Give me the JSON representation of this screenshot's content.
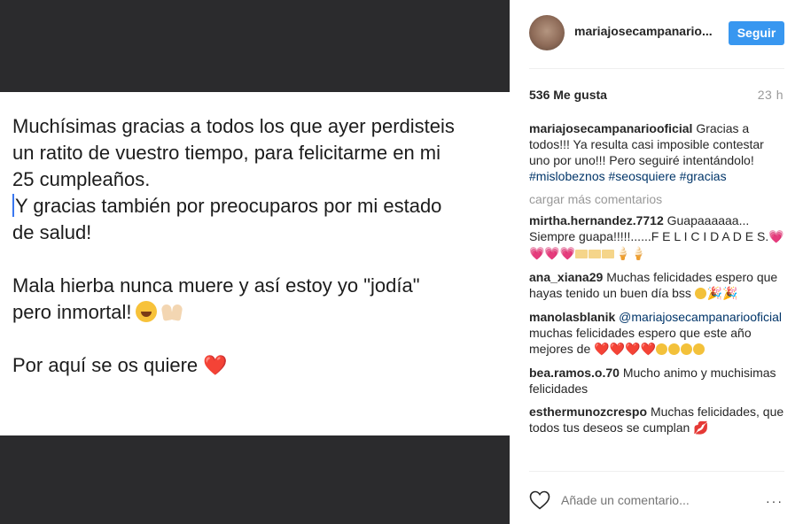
{
  "post": {
    "line1": "Muchísimas gracias a todos los que ayer perdisteis",
    "line2": "un ratito de vuestro tiempo, para felicitarme en mi",
    "line3": "25 cumpleaños.",
    "line4": "Y gracias también por preocuparos por mi estado",
    "line5": "de salud!",
    "line6": "Mala hierba nunca muere y así estoy yo \"jodía\"",
    "line7": "pero inmortal!",
    "line8": "Por aquí se os quiere",
    "heart": "❤️"
  },
  "header": {
    "username": "mariajosecampanario...",
    "follow_label": "Seguir"
  },
  "stats": {
    "likes": "536 Me gusta",
    "time": "23 h"
  },
  "caption": {
    "user": "mariajosecampanariooficial",
    "text": "Gracias a todos!!! Ya resulta casi imposible contestar uno por uno!!! Pero seguiré intentándolo!",
    "tag1": "#mislobeznos",
    "tag2": "#seosquiere",
    "tag3": "#gracias"
  },
  "load_more": "cargar más comentarios",
  "comments": [
    {
      "user": "mirtha.hernandez.7712",
      "text": "Guapaaaaaa... Siempre guapa!!!!!......F E L I C I D A D E S.",
      "emoji": "💗💗💗💗"
    },
    {
      "user": "ana_xiana29",
      "text": "Muchas felicidades espero que hayas tenido un buen día bss",
      "emoji": "🎉🎉"
    },
    {
      "user": "manolasblanik",
      "mention": "@mariajosecampanariooficial",
      "text": "muchas felicidades espero que este año mejores de",
      "emoji": "❤️❤️❤️❤️"
    },
    {
      "user": "bea.ramos.o.70",
      "text": "Mucho animo y muchisimas felicidades"
    },
    {
      "user": "esthermunozcrespo",
      "text": "Muchas felicidades, que todos tus deseos se cumplan",
      "emoji": "💋"
    }
  ],
  "footer": {
    "placeholder": "Añade un comentario...",
    "more": "···"
  },
  "colors": {
    "follow": "#3897f0",
    "link": "#003569",
    "muted": "#999999",
    "media_bg": "#2b2b2d"
  }
}
